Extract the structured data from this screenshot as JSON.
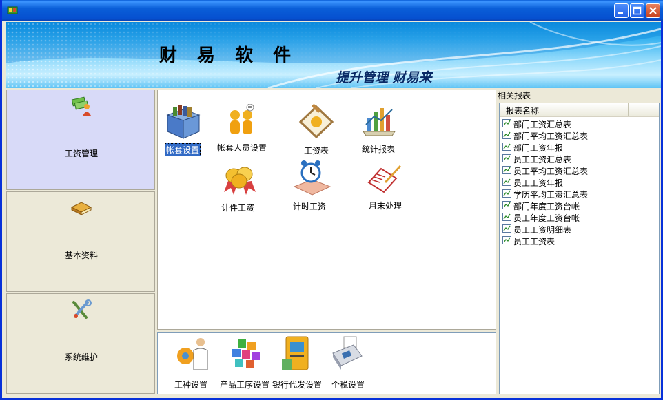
{
  "banner": {
    "title": "财 易 软 件",
    "slogan": "提升管理 财易来"
  },
  "left_nav": {
    "items": [
      {
        "label": "工资管理",
        "icon": "salary-money-icon",
        "active": true
      },
      {
        "label": "基本资料",
        "icon": "book-icon",
        "active": false
      },
      {
        "label": "系统维护",
        "icon": "tools-icon",
        "active": false
      }
    ]
  },
  "main": {
    "tiles": [
      {
        "label": "帐套设置",
        "icon": "account-box-icon",
        "selected": true
      },
      {
        "label": "帐套人员设置",
        "icon": "people-icon",
        "selected": false
      },
      {
        "label": "工资表",
        "icon": "salary-sheet-icon",
        "selected": false
      },
      {
        "label": "统计报表",
        "icon": "chart-report-icon",
        "selected": false
      },
      {
        "label": "计件工资",
        "icon": "coins-icon",
        "selected": false
      },
      {
        "label": "计时工资",
        "icon": "alarm-clock-icon",
        "selected": false
      },
      {
        "label": "月末处理",
        "icon": "notepad-icon",
        "selected": false
      }
    ]
  },
  "bottom": {
    "tiles": [
      {
        "label": "工种设置",
        "icon": "worker-icon"
      },
      {
        "label": "产品工序设置",
        "icon": "blocks-icon"
      },
      {
        "label": "银行代发设置",
        "icon": "atm-icon"
      },
      {
        "label": "个税设置",
        "icon": "pos-terminal-icon"
      }
    ]
  },
  "reports": {
    "title": "相关报表",
    "column_header": "报表名称",
    "items": [
      "部门工资汇总表",
      "部门平均工资汇总表",
      "部门工资年报",
      "员工工资汇总表",
      "员工平均工资汇总表",
      "员工工资年报",
      "学历平均工资汇总表",
      "部门年度工资台帐",
      "员工年度工资台帐",
      "员工工资明细表",
      "员工工资表"
    ]
  },
  "colors": {
    "title_bar": "#0a5fd8",
    "nav_active": "#d8daf8",
    "selection": "#316ac5"
  }
}
